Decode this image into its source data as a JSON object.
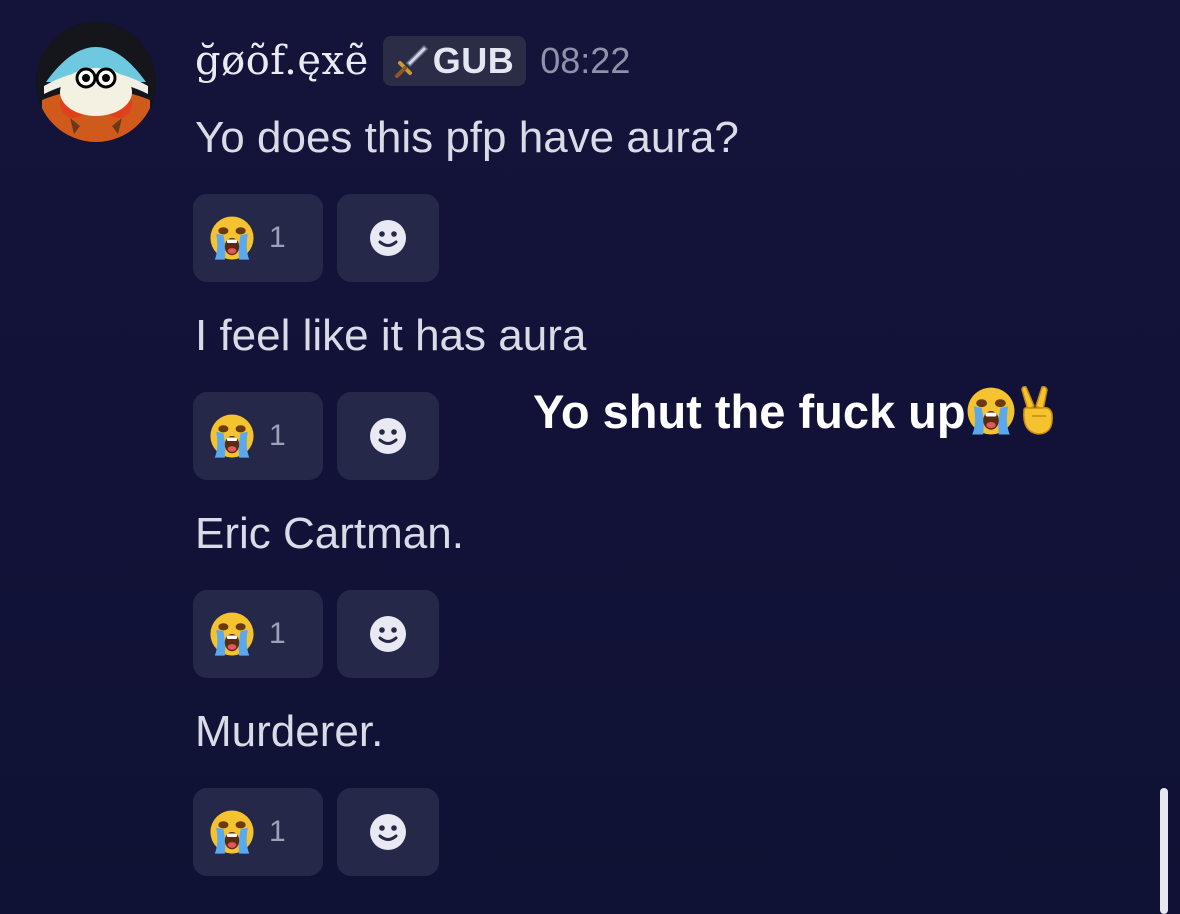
{
  "message": {
    "author": "ğøõf.ęxẽ",
    "tag": {
      "icon": "sword-icon",
      "label": "GUB"
    },
    "time": "08:22"
  },
  "lines": [
    {
      "text": "Yo does this pfp have aura?",
      "reaction": {
        "emoji": "loudly-crying-face",
        "count": "1"
      }
    },
    {
      "text": "I feel like it has aura",
      "reaction": {
        "emoji": "loudly-crying-face",
        "count": "1"
      }
    },
    {
      "text": "Eric Cartman.",
      "reaction": {
        "emoji": "loudly-crying-face",
        "count": "1"
      }
    },
    {
      "text": "Murderer.",
      "reaction": {
        "emoji": "loudly-crying-face",
        "count": "1"
      }
    }
  ],
  "overlay_caption": {
    "text": "Yo shut the fuck up",
    "emojis": [
      "loudly-crying-face",
      "victory-hand"
    ]
  },
  "colors": {
    "background": "#14143a",
    "reaction_bg": "#26284a",
    "text": "#d9dbe7",
    "caption": "#ffffff"
  }
}
